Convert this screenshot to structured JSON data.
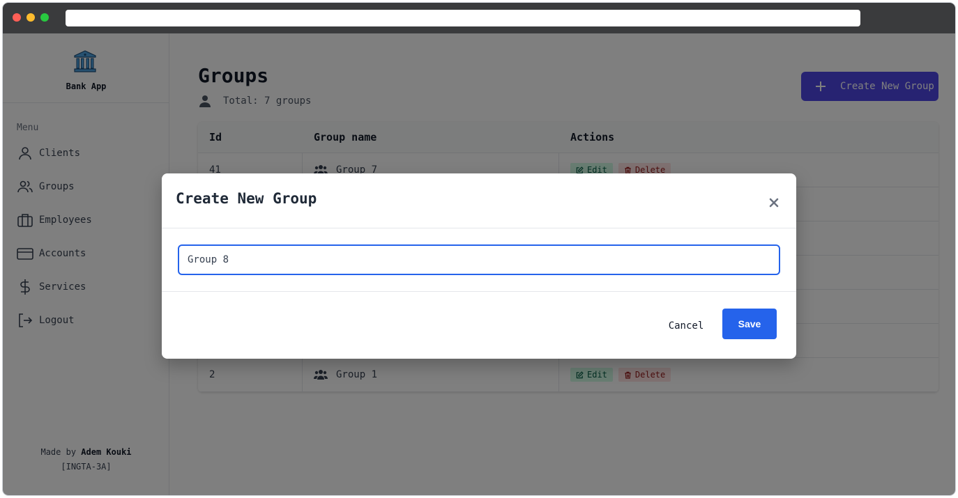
{
  "app": {
    "name": "Bank App"
  },
  "sidebar": {
    "menu_title": "Menu",
    "items": [
      {
        "label": "Clients",
        "icon": "user-icon"
      },
      {
        "label": "Groups",
        "icon": "users-icon"
      },
      {
        "label": "Employees",
        "icon": "briefcase-icon"
      },
      {
        "label": "Accounts",
        "icon": "credit-card-icon"
      },
      {
        "label": "Services",
        "icon": "dollar-icon"
      },
      {
        "label": "Logout",
        "icon": "logout-icon"
      }
    ],
    "footer": {
      "prefix": "Made by",
      "author": "Adem Kouki",
      "class": "[INGTA-3A]"
    }
  },
  "page": {
    "title": "Groups",
    "total": "Total: 7 groups",
    "create_button": "Create New Group"
  },
  "table": {
    "headers": [
      "Id",
      "Group name",
      "Actions"
    ],
    "rows": [
      {
        "id": "41",
        "name": "Group 7"
      },
      {
        "id": "",
        "name": ""
      },
      {
        "id": "",
        "name": ""
      },
      {
        "id": "",
        "name": ""
      },
      {
        "id": "",
        "name": ""
      },
      {
        "id": "",
        "name": ""
      },
      {
        "id": "2",
        "name": "Group 1"
      }
    ],
    "edit_label": "Edit",
    "delete_label": "Delete"
  },
  "modal": {
    "title": "Create New Group",
    "input_value": "Group 8",
    "cancel_label": "Cancel",
    "save_label": "Save"
  },
  "colors": {
    "accent": "#4f46e5",
    "primary": "#2563eb",
    "edit_bg": "#d1fae5",
    "delete_bg": "#fee2e2",
    "brand_icon": "#3b82f6"
  }
}
